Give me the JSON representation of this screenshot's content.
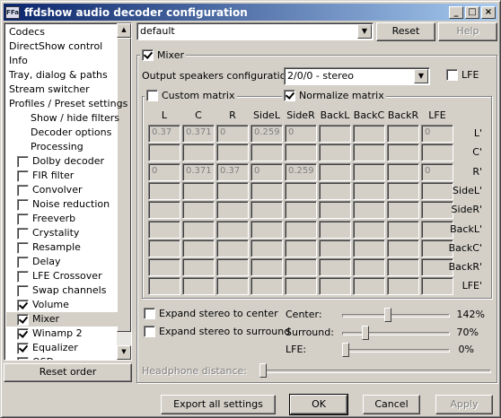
{
  "window": {
    "title": "ffdshow audio decoder configuration",
    "icon_text": "FFa"
  },
  "tree": {
    "items": [
      {
        "label": "Codecs",
        "checkbox": false
      },
      {
        "label": "DirectShow control",
        "checkbox": false
      },
      {
        "label": "Info",
        "checkbox": false
      },
      {
        "label": "Tray, dialog & paths",
        "checkbox": false
      },
      {
        "label": "Stream switcher",
        "checkbox": false
      },
      {
        "label": "Profiles / Preset settings",
        "checkbox": false
      },
      {
        "label": "Show / hide filters",
        "checkbox": false,
        "indent": true
      },
      {
        "label": "Decoder options",
        "checkbox": false,
        "indent": true
      },
      {
        "label": "Processing",
        "checkbox": false,
        "indent": true
      },
      {
        "label": "Dolby decoder",
        "checkbox": true,
        "checked": false
      },
      {
        "label": "FIR filter",
        "checkbox": true,
        "checked": false
      },
      {
        "label": "Convolver",
        "checkbox": true,
        "checked": false
      },
      {
        "label": "Noise reduction",
        "checkbox": true,
        "checked": false
      },
      {
        "label": "Freeverb",
        "checkbox": true,
        "checked": false
      },
      {
        "label": "Crystality",
        "checkbox": true,
        "checked": false
      },
      {
        "label": "Resample",
        "checkbox": true,
        "checked": false
      },
      {
        "label": "Delay",
        "checkbox": true,
        "checked": false
      },
      {
        "label": "LFE Crossover",
        "checkbox": true,
        "checked": false
      },
      {
        "label": "Swap channels",
        "checkbox": true,
        "checked": false
      },
      {
        "label": "Volume",
        "checkbox": true,
        "checked": true
      },
      {
        "label": "Mixer",
        "checkbox": true,
        "checked": true,
        "selected": true
      },
      {
        "label": "Winamp 2",
        "checkbox": true,
        "checked": true
      },
      {
        "label": "Equalizer",
        "checkbox": true,
        "checked": true
      },
      {
        "label": "OSD",
        "checkbox": true,
        "checked": true
      }
    ]
  },
  "reset_order_label": "Reset order",
  "preset": {
    "value": "default",
    "reset_label": "Reset",
    "help_label": "Help"
  },
  "mixer": {
    "enabled_label": "Mixer",
    "enabled": true,
    "speakers_label": "Output speakers configuration:",
    "speakers_value": "2/0/0 - stereo",
    "lfe_label": "LFE",
    "lfe_checked": false,
    "custom_matrix_label": "Custom matrix",
    "custom_matrix_checked": false,
    "normalize_label": "Normalize matrix",
    "normalize_checked": true,
    "columns": [
      "L",
      "C",
      "R",
      "SideL",
      "SideR",
      "BackL",
      "BackC",
      "BackR",
      "LFE"
    ],
    "rows": [
      {
        "label": "L'",
        "values": [
          "0.37",
          "0.371",
          "0",
          "0.259",
          "0",
          "",
          "",
          "",
          "0"
        ]
      },
      {
        "label": "C'",
        "values": [
          "",
          "",
          "",
          "",
          "",
          "",
          "",
          "",
          ""
        ]
      },
      {
        "label": "R'",
        "values": [
          "0",
          "0.371",
          "0.37",
          "0",
          "0.259",
          "",
          "",
          "",
          "0"
        ]
      },
      {
        "label": "SideL'",
        "values": [
          "",
          "",
          "",
          "",
          "",
          "",
          "",
          "",
          ""
        ]
      },
      {
        "label": "SideR'",
        "values": [
          "",
          "",
          "",
          "",
          "",
          "",
          "",
          "",
          ""
        ]
      },
      {
        "label": "BackL'",
        "values": [
          "",
          "",
          "",
          "",
          "",
          "",
          "",
          "",
          ""
        ]
      },
      {
        "label": "BackC'",
        "values": [
          "",
          "",
          "",
          "",
          "",
          "",
          "",
          "",
          ""
        ]
      },
      {
        "label": "BackR'",
        "values": [
          "",
          "",
          "",
          "",
          "",
          "",
          "",
          "",
          ""
        ]
      },
      {
        "label": "LFE'",
        "values": [
          "",
          "",
          "",
          "",
          "",
          "",
          "",
          "",
          ""
        ]
      }
    ],
    "expand_center_label": "Expand stereo to center",
    "expand_center_checked": false,
    "expand_surround_label": "Expand stereo to surround",
    "expand_surround_checked": false,
    "center": {
      "label": "Center:",
      "value": "142%",
      "level": 0.42
    },
    "surround": {
      "label": "Surround:",
      "value": "70%",
      "level": 0.2
    },
    "lfe": {
      "label": "LFE:",
      "value": "0%",
      "level": 0.0
    },
    "headphone": {
      "label": "Headphone distance:",
      "level": 0.0,
      "enabled": false
    }
  },
  "footer": {
    "export_label": "Export all settings",
    "ok_label": "OK",
    "cancel_label": "Cancel",
    "apply_label": "Apply"
  }
}
